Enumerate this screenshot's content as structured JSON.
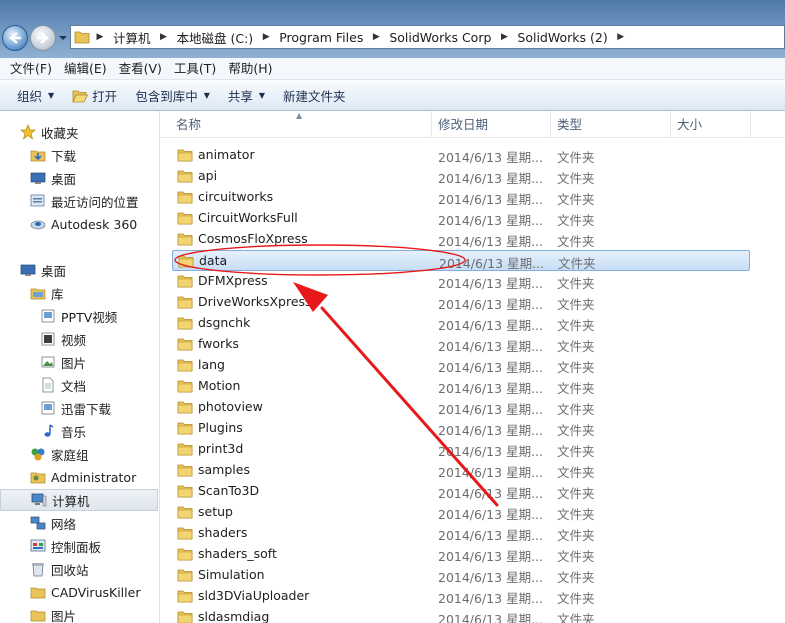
{
  "address_bar": {
    "breadcrumbs": [
      "计算机",
      "本地磁盘 (C:)",
      "Program Files",
      "SolidWorks Corp",
      "SolidWorks (2)"
    ]
  },
  "menu": [
    "文件(F)",
    "编辑(E)",
    "查看(V)",
    "工具(T)",
    "帮助(H)"
  ],
  "toolbar": {
    "organize": "组织",
    "open": "打开",
    "include_in_library": "包含到库中",
    "share": "共享",
    "new_folder": "新建文件夹"
  },
  "nav": {
    "favorites": "收藏夹",
    "favorites_items": [
      "下载",
      "桌面",
      "最近访问的位置",
      "Autodesk 360"
    ],
    "desktop": "桌面",
    "library": "库",
    "library_items": [
      "PPTV视频",
      "视频",
      "图片",
      "文档",
      "迅雷下载",
      "音乐"
    ],
    "homegroup": "家庭组",
    "administrator": "Administrator",
    "computer": "计算机",
    "network": "网络",
    "control_panel": "控制面板",
    "recycle_bin": "回收站",
    "cadvk": "CADVirusKiller",
    "pictures": "图片"
  },
  "columns": {
    "name": "名称",
    "modified": "修改日期",
    "type": "类型",
    "size": "大小"
  },
  "files": [
    {
      "name": "animator",
      "date": "2014/6/13 星期...",
      "type": "文件夹"
    },
    {
      "name": "api",
      "date": "2014/6/13 星期...",
      "type": "文件夹"
    },
    {
      "name": "circuitworks",
      "date": "2014/6/13 星期...",
      "type": "文件夹"
    },
    {
      "name": "CircuitWorksFull",
      "date": "2014/6/13 星期...",
      "type": "文件夹"
    },
    {
      "name": "CosmosFloXpress",
      "date": "2014/6/13 星期...",
      "type": "文件夹"
    },
    {
      "name": "data",
      "date": "2014/6/13 星期...",
      "type": "文件夹"
    },
    {
      "name": "DFMXpress",
      "date": "2014/6/13 星期...",
      "type": "文件夹"
    },
    {
      "name": "DriveWorksXpress",
      "date": "2014/6/13 星期...",
      "type": "文件夹"
    },
    {
      "name": "dsgnchk",
      "date": "2014/6/13 星期...",
      "type": "文件夹"
    },
    {
      "name": "fworks",
      "date": "2014/6/13 星期...",
      "type": "文件夹"
    },
    {
      "name": "lang",
      "date": "2014/6/13 星期...",
      "type": "文件夹"
    },
    {
      "name": "Motion",
      "date": "2014/6/13 星期...",
      "type": "文件夹"
    },
    {
      "name": "photoview",
      "date": "2014/6/13 星期...",
      "type": "文件夹"
    },
    {
      "name": "Plugins",
      "date": "2014/6/13 星期...",
      "type": "文件夹"
    },
    {
      "name": "print3d",
      "date": "2014/6/13 星期...",
      "type": "文件夹"
    },
    {
      "name": "samples",
      "date": "2014/6/13 星期...",
      "type": "文件夹"
    },
    {
      "name": "ScanTo3D",
      "date": "2014/6/13 星期...",
      "type": "文件夹"
    },
    {
      "name": "setup",
      "date": "2014/6/13 星期...",
      "type": "文件夹"
    },
    {
      "name": "shaders",
      "date": "2014/6/13 星期...",
      "type": "文件夹"
    },
    {
      "name": "shaders_soft",
      "date": "2014/6/13 星期...",
      "type": "文件夹"
    },
    {
      "name": "Simulation",
      "date": "2014/6/13 星期...",
      "type": "文件夹"
    },
    {
      "name": "sld3DViaUploader",
      "date": "2014/6/13 星期...",
      "type": "文件夹"
    },
    {
      "name": "sldasmdiag",
      "date": "2014/6/13 星期...",
      "type": "文件夹"
    }
  ],
  "selected_file": "data",
  "colors": {
    "selection": "#c7def6",
    "annotation": "#e8191b"
  }
}
